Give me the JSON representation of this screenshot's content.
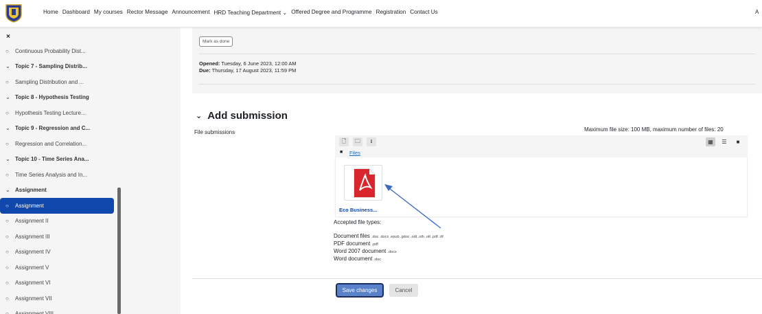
{
  "nav": {
    "items": [
      "Home",
      "Dashboard",
      "My courses",
      "Rector Message",
      "Announcement",
      "HRD Teaching Department ⌄",
      "Offered Degree and Programme",
      "Registration",
      "Contact Us"
    ],
    "right_text": "A"
  },
  "sidebar": {
    "close": "×",
    "items": [
      {
        "label": "Continuous Probability Dist...",
        "type": "item"
      },
      {
        "label": "Topic 7 - Sampling Distrib...",
        "type": "section"
      },
      {
        "label": "Sampling Distribution and ...",
        "type": "item"
      },
      {
        "label": "Topic 8 - Hypothesis Testing",
        "type": "section"
      },
      {
        "label": "Hypothesis Testing Lecture...",
        "type": "item"
      },
      {
        "label": "Topic 9 - Regression and C...",
        "type": "section"
      },
      {
        "label": "Regression and Correlation...",
        "type": "item"
      },
      {
        "label": "Topic 10 - Time Series Ana...",
        "type": "section"
      },
      {
        "label": "Time Series Analysis and In...",
        "type": "item"
      },
      {
        "label": "Assignment",
        "type": "section"
      },
      {
        "label": "Assignment",
        "type": "active"
      },
      {
        "label": "Assignment II",
        "type": "item"
      },
      {
        "label": "Assignment III",
        "type": "item"
      },
      {
        "label": "Assignment IV",
        "type": "item"
      },
      {
        "label": "Assignment V",
        "type": "item"
      },
      {
        "label": "Assignment VI",
        "type": "item"
      },
      {
        "label": "Assignment VII",
        "type": "item"
      },
      {
        "label": "Assignment VIII",
        "type": "item"
      }
    ]
  },
  "activity": {
    "mark_done": "Mark as done",
    "opened_label": "Opened:",
    "opened_value": " Tuesday, 6 June 2023, 12:00 AM",
    "due_label": "Due:",
    "due_value": " Thursday, 17 August 2023, 11:59 PM"
  },
  "submission": {
    "heading": "Add submission",
    "file_submissions_label": "File submissions",
    "max_info": "Maximum file size: 100 MB, maximum number of files: 20",
    "path_label": "Files",
    "file_name": "Eco Business...",
    "accepted_title": "Accepted file types:",
    "types": [
      {
        "name": "Document files",
        "ext": ".doc .docx .epub .gdoc .odt .oth .ott .pdf .rtf"
      },
      {
        "name": "PDF document",
        "ext": ".pdf"
      },
      {
        "name": "Word 2007 document",
        "ext": ".docx"
      },
      {
        "name": "Word document",
        "ext": ".doc"
      }
    ],
    "save_label": "Save changes",
    "cancel_label": "Cancel"
  },
  "colors": {
    "accent": "#0f47ad",
    "link": "#0f6cbf",
    "pdf_red": "#d9262c"
  }
}
